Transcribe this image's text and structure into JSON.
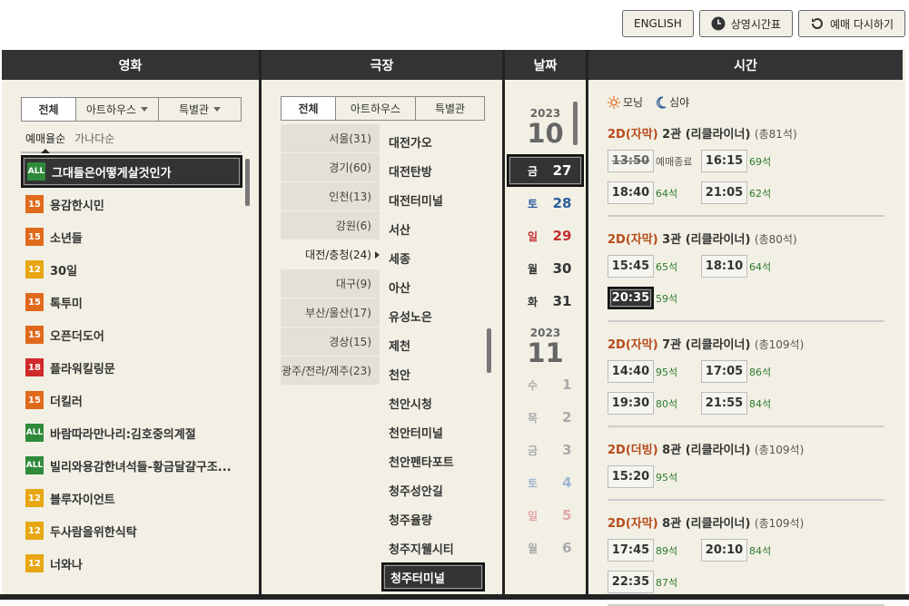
{
  "top_buttons": {
    "english": "ENGLISH",
    "schedule": "상영시간표",
    "reset": "예매 다시하기"
  },
  "columns": {
    "movie": "영화",
    "theater": "극장",
    "date": "날짜",
    "time": "시간"
  },
  "movie_tabs": [
    "전체",
    "아트하우스",
    "특별관"
  ],
  "movie_sort": [
    "예매율순",
    "가나다순"
  ],
  "movies": [
    {
      "rating": "ALL",
      "title": "그대들은어떻게살것인가",
      "color": "#2f8a3c"
    },
    {
      "rating": "15",
      "title": "용감한시민",
      "color": "#e06a1c"
    },
    {
      "rating": "15",
      "title": "소년들",
      "color": "#e06a1c"
    },
    {
      "rating": "12",
      "title": "30일",
      "color": "#e8a612"
    },
    {
      "rating": "15",
      "title": "톡투미",
      "color": "#e06a1c"
    },
    {
      "rating": "15",
      "title": "오픈더도어",
      "color": "#e06a1c"
    },
    {
      "rating": "18",
      "title": "플라워킬링문",
      "color": "#d12a2a"
    },
    {
      "rating": "15",
      "title": "더킬러",
      "color": "#e06a1c"
    },
    {
      "rating": "ALL",
      "title": "바람따라만나리:김호중의계절",
      "color": "#2f8a3c"
    },
    {
      "rating": "ALL",
      "title": "빌리와용감한녀석들-황금달걀구조...",
      "color": "#2f8a3c"
    },
    {
      "rating": "12",
      "title": "블루자이언트",
      "color": "#e8a612"
    },
    {
      "rating": "12",
      "title": "두사람을위한식탁",
      "color": "#e8a612"
    },
    {
      "rating": "12",
      "title": "너와나",
      "color": "#e8a612"
    }
  ],
  "theater_tabs": [
    "전체",
    "아트하우스",
    "특별관"
  ],
  "regions": [
    "서울(31)",
    "경기(60)",
    "인천(13)",
    "강원(6)",
    "대전/충청(24)",
    "대구(9)",
    "부산/울산(17)",
    "경상(15)",
    "광주/전라/제주(23)"
  ],
  "theaters": [
    "대전가오",
    "대전탄방",
    "대전터미널",
    "서산",
    "세종",
    "아산",
    "유성노은",
    "제천",
    "천안",
    "천안시청",
    "천안터미널",
    "천안펜타포트",
    "청주성안길",
    "청주율량",
    "청주지웰시티",
    "청주터미널"
  ],
  "dates": {
    "oct": {
      "year": "2023",
      "month": "10"
    },
    "nov": {
      "year": "2023",
      "month": "11"
    },
    "oct_days": [
      {
        "dw": "금",
        "dn": "27",
        "color": "#ffffff"
      },
      {
        "dw": "토",
        "dn": "28",
        "color": "#2b5c9a"
      },
      {
        "dw": "일",
        "dn": "29",
        "color": "#c03030"
      },
      {
        "dw": "월",
        "dn": "30",
        "color": "#333333"
      },
      {
        "dw": "화",
        "dn": "31",
        "color": "#333333"
      }
    ],
    "nov_days": [
      {
        "dw": "수",
        "dn": "1",
        "color": "#aaaaaa"
      },
      {
        "dw": "목",
        "dn": "2",
        "color": "#aaaaaa"
      },
      {
        "dw": "금",
        "dn": "3",
        "color": "#aaaaaa"
      },
      {
        "dw": "토",
        "dn": "4",
        "color": "#9fb4cf"
      },
      {
        "dw": "일",
        "dn": "5",
        "color": "#e2a6a6"
      },
      {
        "dw": "월",
        "dn": "6",
        "color": "#aaaaaa"
      }
    ]
  },
  "legend": {
    "morning": "모닝",
    "night": "심야"
  },
  "showtimes": [
    {
      "fmt": "2D(자막)",
      "hall": "2관 (리클라이너)",
      "total": "(총81석)",
      "times": [
        {
          "t": "13:50",
          "s": "예매종료",
          "state": "closed"
        },
        {
          "t": "16:15",
          "s": "69석",
          "state": ""
        },
        {
          "t": "18:40",
          "s": "64석",
          "state": ""
        },
        {
          "t": "21:05",
          "s": "62석",
          "state": ""
        }
      ]
    },
    {
      "fmt": "2D(자막)",
      "hall": "3관 (리클라이너)",
      "total": "(총80석)",
      "times": [
        {
          "t": "15:45",
          "s": "65석",
          "state": ""
        },
        {
          "t": "18:10",
          "s": "64석",
          "state": ""
        },
        {
          "t": "20:35",
          "s": "59석",
          "state": "sel"
        }
      ]
    },
    {
      "fmt": "2D(자막)",
      "hall": "7관 (리클라이너)",
      "total": "(총109석)",
      "times": [
        {
          "t": "14:40",
          "s": "95석",
          "state": ""
        },
        {
          "t": "17:05",
          "s": "86석",
          "state": ""
        },
        {
          "t": "19:30",
          "s": "80석",
          "state": ""
        },
        {
          "t": "21:55",
          "s": "84석",
          "state": ""
        }
      ]
    },
    {
      "fmt": "2D(더빙)",
      "hall": "8관 (리클라이너)",
      "total": "(총109석)",
      "times": [
        {
          "t": "15:20",
          "s": "95석",
          "state": ""
        }
      ]
    },
    {
      "fmt": "2D(자막)",
      "hall": "8관 (리클라이너)",
      "total": "(총109석)",
      "times": [
        {
          "t": "17:45",
          "s": "89석",
          "state": ""
        },
        {
          "t": "20:10",
          "s": "84석",
          "state": ""
        },
        {
          "t": "22:35",
          "s": "87석",
          "state": ""
        }
      ]
    }
  ]
}
